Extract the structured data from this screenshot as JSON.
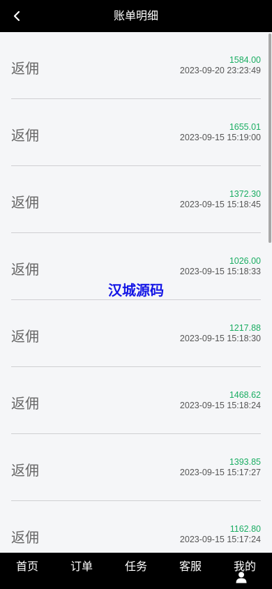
{
  "header": {
    "title": "账单明细"
  },
  "records": [
    {
      "title": "返佣",
      "amount": "1584.00",
      "time": "2023-09-20 23:23:49"
    },
    {
      "title": "返佣",
      "amount": "1655.01",
      "time": "2023-09-15 15:19:00"
    },
    {
      "title": "返佣",
      "amount": "1372.30",
      "time": "2023-09-15 15:18:45"
    },
    {
      "title": "返佣",
      "amount": "1026.00",
      "time": "2023-09-15 15:18:33"
    },
    {
      "title": "返佣",
      "amount": "1217.88",
      "time": "2023-09-15 15:18:30"
    },
    {
      "title": "返佣",
      "amount": "1468.62",
      "time": "2023-09-15 15:18:24"
    },
    {
      "title": "返佣",
      "amount": "1393.85",
      "time": "2023-09-15 15:17:27"
    },
    {
      "title": "返佣",
      "amount": "1162.80",
      "time": "2023-09-15 15:17:24"
    }
  ],
  "watermark": "汉城源码",
  "tabbar": {
    "items": [
      {
        "label": "首页",
        "icon": "home-icon"
      },
      {
        "label": "订单",
        "icon": "order-icon"
      },
      {
        "label": "任务",
        "icon": "task-icon"
      },
      {
        "label": "客服",
        "icon": "service-icon"
      },
      {
        "label": "我的",
        "icon": "user-icon"
      }
    ]
  },
  "colors": {
    "amount": "#1aad62",
    "bar": "#000000",
    "watermark": "#1416e6"
  }
}
